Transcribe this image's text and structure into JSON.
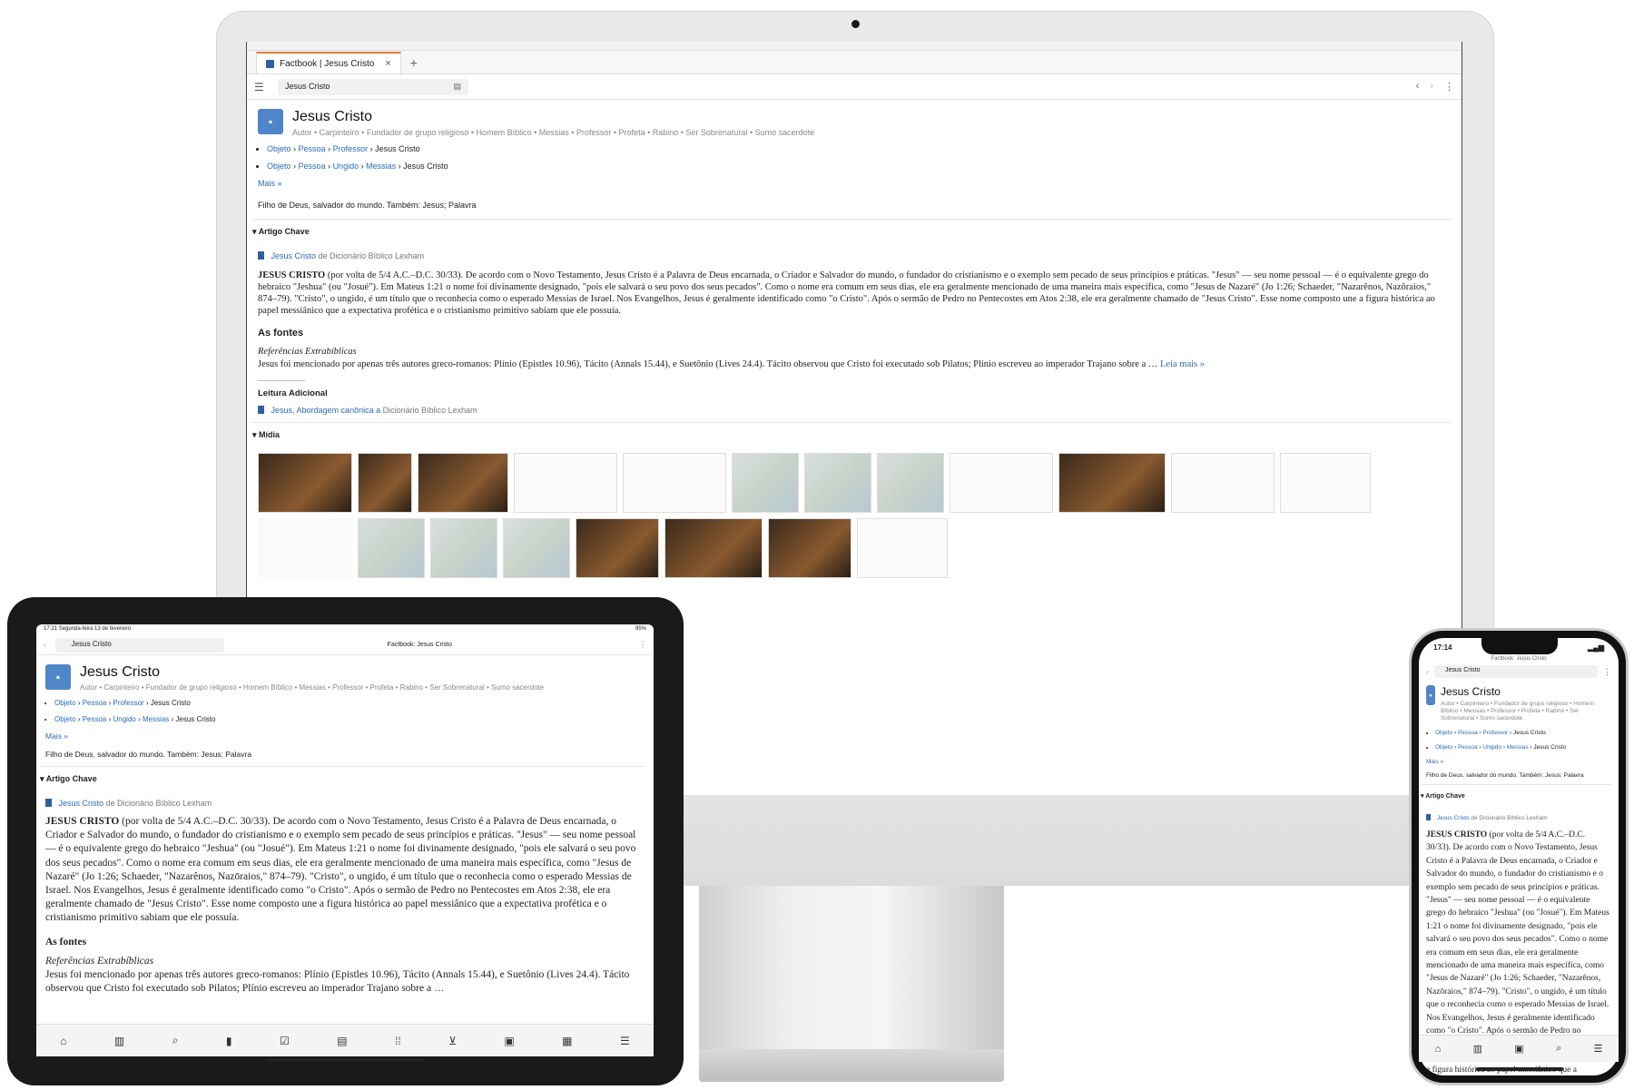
{
  "desktop": {
    "tab_label": "Factbook | Jesus Cristo",
    "tab_close": "×",
    "new_tab": "+",
    "search_value": "Jesus Cristo",
    "entity": {
      "title": "Jesus Cristo",
      "roles": "Autor • Carpinteiro • Fundador de grupo religioso • Homem Bíblico • Messias • Professor • Profeta • Rabino • Ser Sobrenatural • Sumo sacerdote",
      "bc1": [
        "Objeto",
        "Pessoa",
        "Professor",
        "Jesus Cristo"
      ],
      "bc2": [
        "Objeto",
        "Pessoa",
        "Ungido",
        "Messias",
        "Jesus Cristo"
      ],
      "more": "Mais »",
      "summary": "Filho de Deus, salvador do mundo. Também: Jesus; Palavra"
    },
    "key_article": {
      "heading": "Artigo Chave",
      "source_link": "Jesus Cristo",
      "source_from": "de Dicionário Bíblico Lexham",
      "lead": "JESUS CRISTO",
      "text": " (por volta de 5/4 A.C.–D.C. 30/33). De acordo com o Novo Testamento, Jesus Cristo é a Palavra de Deus encarnada, o Criador e Salvador do mundo, o fundador do cristianismo e o exemplo sem pecado de seus princípios e práticas. \"Jesus\" — seu nome pessoal — é o equivalente grego do hebraico \"Jeshua\" (ou \"Josué\"). Em Mateus 1:21 o nome foi divinamente designado, \"pois ele salvará o seu povo dos seus pecados\". Como o nome era comum em seus dias, ele era geralmente mencionado de uma maneira mais específica, como \"Jesus de Nazaré\" (Jo 1:26; Schaeder, \"Nazarênos, Nazōraios,\" 874–79). \"Cristo\", o ungido, é um título que o reconhecia como o esperado Messias de Israel. Nos Evangelhos, Jesus é geralmente identificado como \"o Cristo\". Após o sermão de Pedro no Pentecostes em Atos 2:38, ele era geralmente chamado de \"Jesus Cristo\". Esse nome composto une a figura histórica ao papel messiânico que a expectativa profética e o cristianismo primitivo sabiam que ele possuía.",
      "sources_heading": "As fontes",
      "extrabiblical": "Referências Extrabíblicas",
      "sources_text": "Jesus foi mencionado por apenas três autores greco-romanos: Plínio (Epistles 10.96), Tácito (Annals 15.44), e Suetônio (Lives 24.4). Tácito observou que Cristo foi executado sob Pilatos; Plínio escreveu ao imperador Trajano sobre a …",
      "read_more": "Leia mais »",
      "further_heading": "Leitura Adicional",
      "further_link": "Jesus, Abordagem canônica a",
      "further_from": "Dicionário Bíblico Lexham"
    },
    "media_heading": "Mídia"
  },
  "tablet": {
    "time": "17:21",
    "date": "Segunda-feira 13 de fevereiro",
    "battery": "85%",
    "search_value": "Jesus Cristo",
    "page_title": "Factbook: Jesus Cristo"
  },
  "phone": {
    "time": "17:14",
    "page_title": "Factbook: Jesus Cristo",
    "search_value": "Jesus Cristo"
  },
  "colors": {
    "accent": "#e07b39",
    "link": "#2a6bb3",
    "avatar": "#4f86c9"
  }
}
